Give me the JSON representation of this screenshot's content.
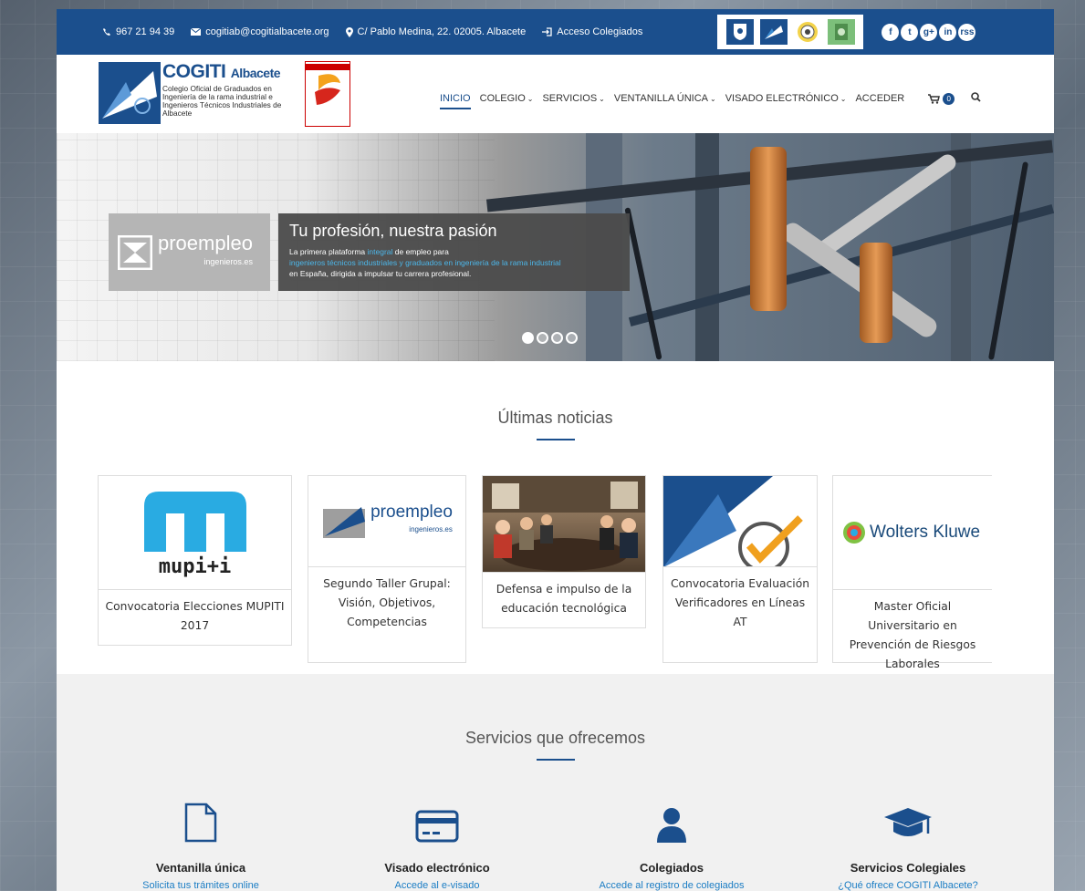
{
  "topbar": {
    "phone": "967 21 94 39",
    "email": "cogitiab@cogitialbacete.org",
    "address": "C/ Pablo Medina, 22. 02005. Albacete",
    "access": "Acceso Colegiados",
    "social": [
      "f",
      "t",
      "g+",
      "in",
      "rss"
    ]
  },
  "brand": {
    "name": "COGITI",
    "city": "Albacete",
    "subtitle": "Colegio Oficial de Graduados en Ingeniería de la rama industrial e Ingenieros Técnicos Industriales de Albacete"
  },
  "nav": {
    "items": [
      {
        "label": "INICIO",
        "active": true,
        "dropdown": false
      },
      {
        "label": "COLEGIO",
        "active": false,
        "dropdown": true
      },
      {
        "label": "SERVICIOS",
        "active": false,
        "dropdown": true
      },
      {
        "label": "VENTANILLA ÚNICA",
        "active": false,
        "dropdown": true
      },
      {
        "label": "VISADO ELECTRÓNICO",
        "active": false,
        "dropdown": true
      },
      {
        "label": "ACCEDER",
        "active": false,
        "dropdown": false
      }
    ],
    "cart_count": "0"
  },
  "hero": {
    "logo_text": "proempleo",
    "logo_sub": "ingenieros.es",
    "headline": "Tu profesión, nuestra pasión",
    "line1_a": "La primera plataforma ",
    "line1_hl": "integral",
    "line1_b": " de empleo para",
    "line2_hl": "ingenieros técnicos industriales y graduados en ingeniería de la rama industrial",
    "line3": "en España, dirigida a impulsar tu carrera profesional."
  },
  "news": {
    "title": "Últimas noticias",
    "cards": [
      {
        "caption": "Convocatoria Elecciones MUPITI 2017",
        "image_text": "mupi+i"
      },
      {
        "caption": "Segundo Taller Grupal: Visión, Objetivos, Competencias",
        "image_text": "proempleo",
        "image_sub": "ingenieros.es"
      },
      {
        "caption": "Defensa e impulso de la educación tecnológica"
      },
      {
        "caption": "Convocatoria Evaluación Verificadores en Líneas AT"
      },
      {
        "caption": "Master Oficial Universitario en Prevención de Riesgos Laborales",
        "image_text": "Wolters Kluwe"
      }
    ]
  },
  "services": {
    "title": "Servicios que ofrecemos",
    "items": [
      {
        "title": "Ventanilla única",
        "link": "Solicita tus trámites online",
        "icon": "document-icon"
      },
      {
        "title": "Visado electrónico",
        "link": "Accede al e-visado",
        "icon": "credit-card-icon"
      },
      {
        "title": "Colegiados",
        "link": "Accede al registro de colegiados",
        "icon": "user-icon"
      },
      {
        "title": "Servicios Colegiales",
        "link": "¿Qué ofrece COGITI Albacete?",
        "icon": "graduation-cap-icon"
      }
    ]
  }
}
